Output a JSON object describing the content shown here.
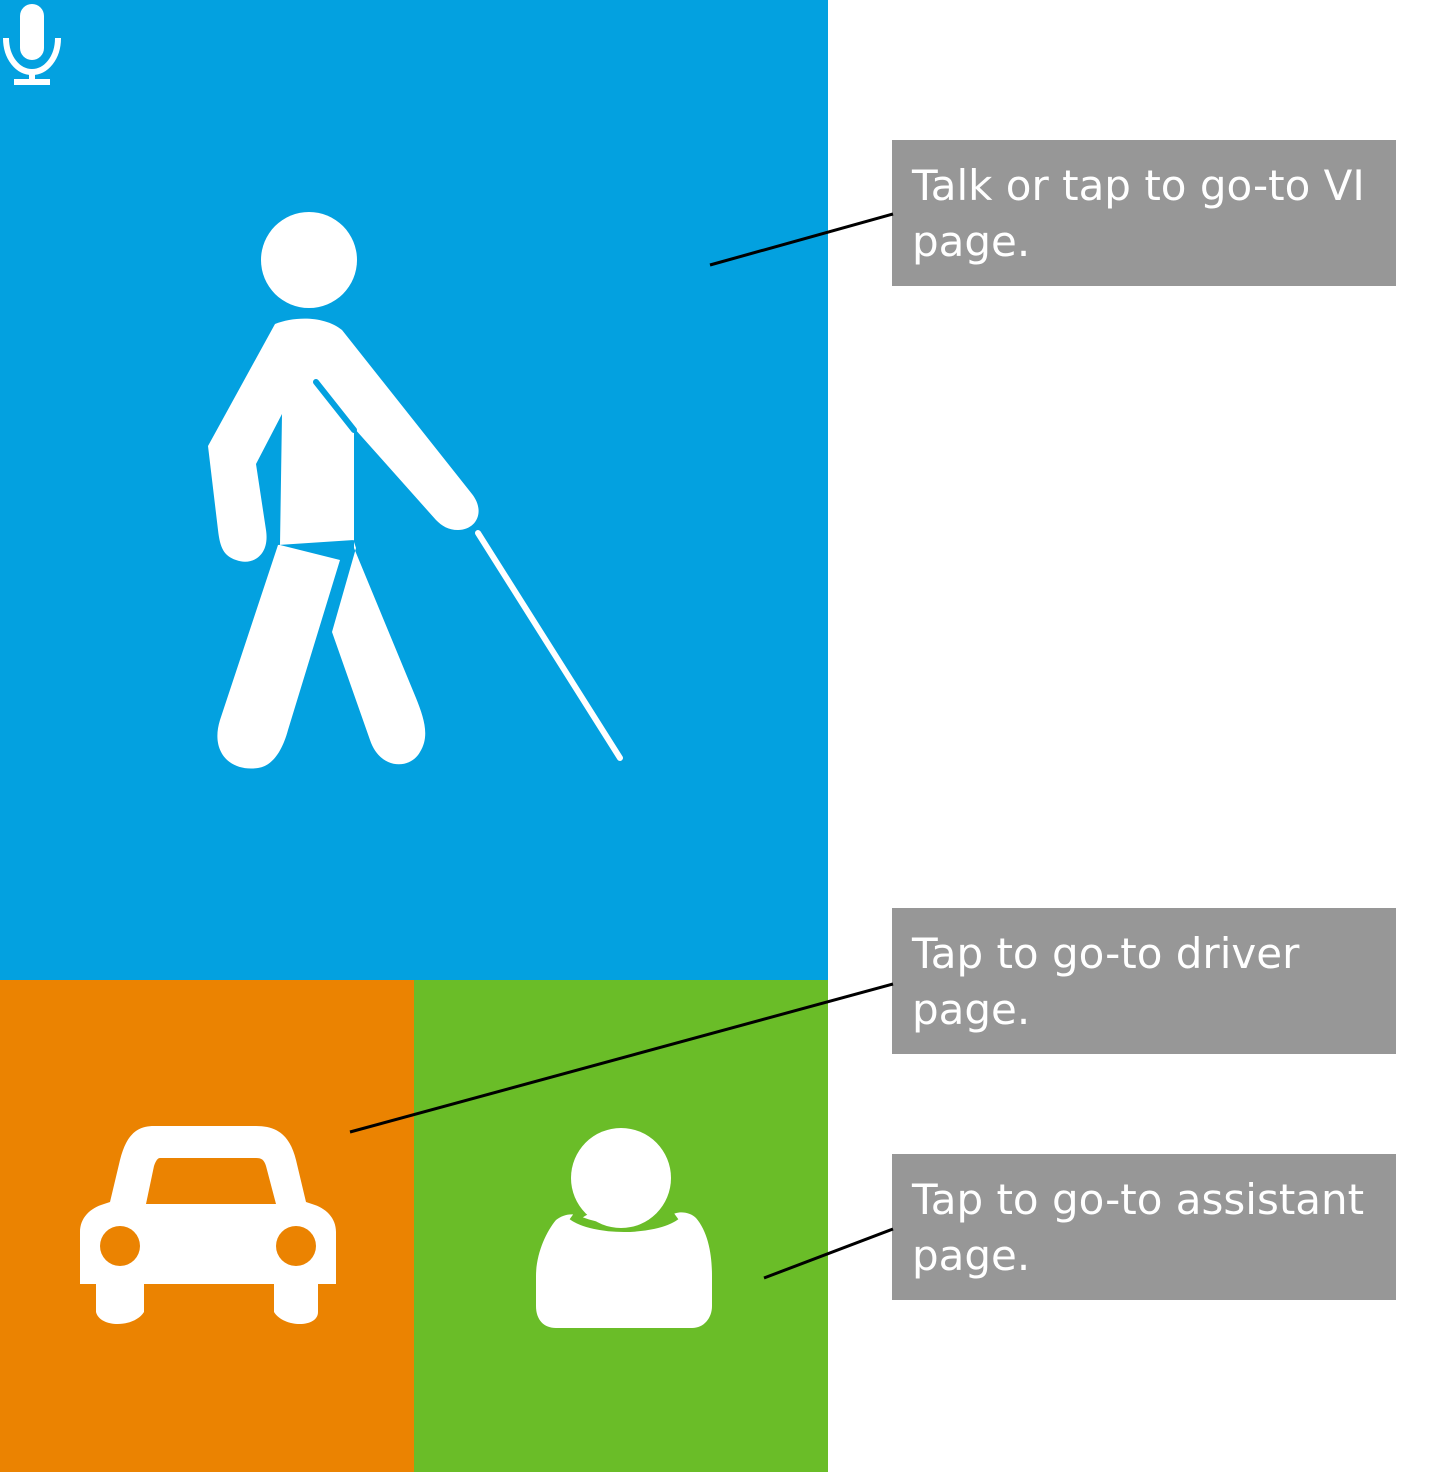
{
  "tiles": {
    "vi": {
      "color": "#03a1e0",
      "icon": "visually-impaired-person-icon",
      "mic_icon": "microphone-icon"
    },
    "driver": {
      "color": "#eb8301",
      "icon": "car-icon"
    },
    "assistant": {
      "color": "#6abd28",
      "icon": "person-icon"
    }
  },
  "callouts": {
    "vi": "Talk or tap to go-to VI page.",
    "driver": "Tap to go-to driver page.",
    "assistant": "Tap to go-to assistant page."
  },
  "colors": {
    "callout_bg": "#979797",
    "callout_text": "#ffffff",
    "leader_line": "#000000",
    "icon": "#ffffff"
  }
}
